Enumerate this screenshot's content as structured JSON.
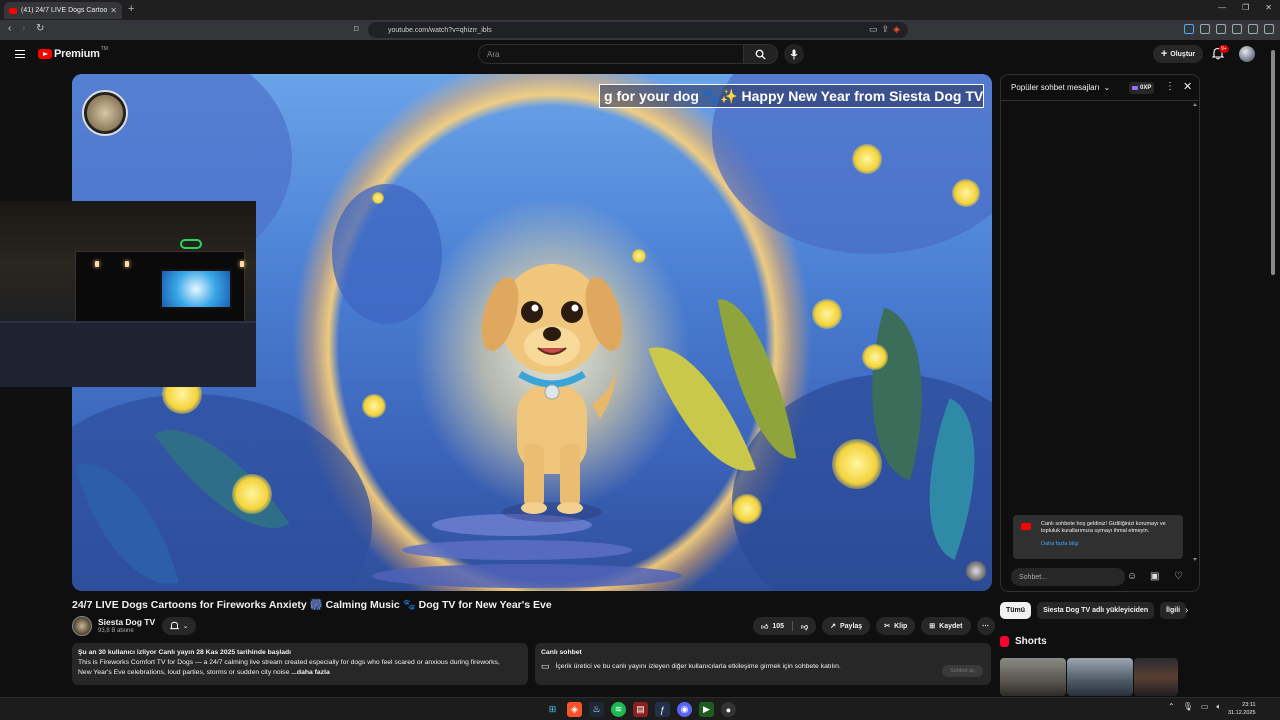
{
  "browser": {
    "tab_title": "(41) 24/7 LIVE Dogs Cartoons",
    "url": "youtube.com/watch?v=qhizrr_ibls"
  },
  "header": {
    "logo_text": "Premium",
    "logo_tm": "TM",
    "search_placeholder": "Ara",
    "create_label": "Oluştur",
    "notification_count": "9+"
  },
  "video": {
    "ticker_text": "g for your dog 🐾✨  Happy New Year from Siesta Dog TV, You're",
    "title": "24/7 LIVE Dogs Cartoons for Fireworks Anxiety 🎆 Calming Music 🐾 Dog TV for New Year's Eve",
    "channel_name": "Siesta Dog TV",
    "subscribers": "93,8 B abone",
    "likes": "105",
    "share_label": "Paylaş",
    "clip_label": "Klip",
    "save_label": "Kaydet"
  },
  "description": {
    "line1": "Şu an 30 kullanıcı izliyor  Canlı yayın 28 Kas 2025 tarihinde başladı",
    "line2": "This is Fireworks Comfort TV for Dogs — a 24/7 calming live stream created especially for dogs who feel scared or anxious during fireworks,",
    "line3": "New Year's Eve celebrations, loud parties, storms or sudden city noise",
    "more": "...daha fazla"
  },
  "live_chat_card": {
    "title": "Canlı sohbet",
    "text": "İçerik üretici ve bu canlı yayını izleyen diğer kullanıcılarla etkileşime girmek için sohbete katılın.",
    "button": "Sohbet aç"
  },
  "chat": {
    "mode": "Popüler sohbet mesajları",
    "xp": "0XP",
    "welcome": "Canlı sohbete hoş geldiniz! Gizliliğinizi korumayı ve topluluk kurallarımıza uymayı ihmal etmeyin.",
    "learn_more": "Daha fazla bilgi",
    "input_placeholder": "Sohbet..."
  },
  "chips": [
    "Tümü",
    "Siesta Dog TV adlı yükleyiciden",
    "İlgili"
  ],
  "shorts": {
    "title": "Shorts"
  },
  "taskbar": {
    "time": "23:11",
    "date": "31.12.2025"
  },
  "colors": {
    "accent": "#ff0000",
    "link": "#3ea6ff",
    "bg": "#0f0f0f"
  }
}
